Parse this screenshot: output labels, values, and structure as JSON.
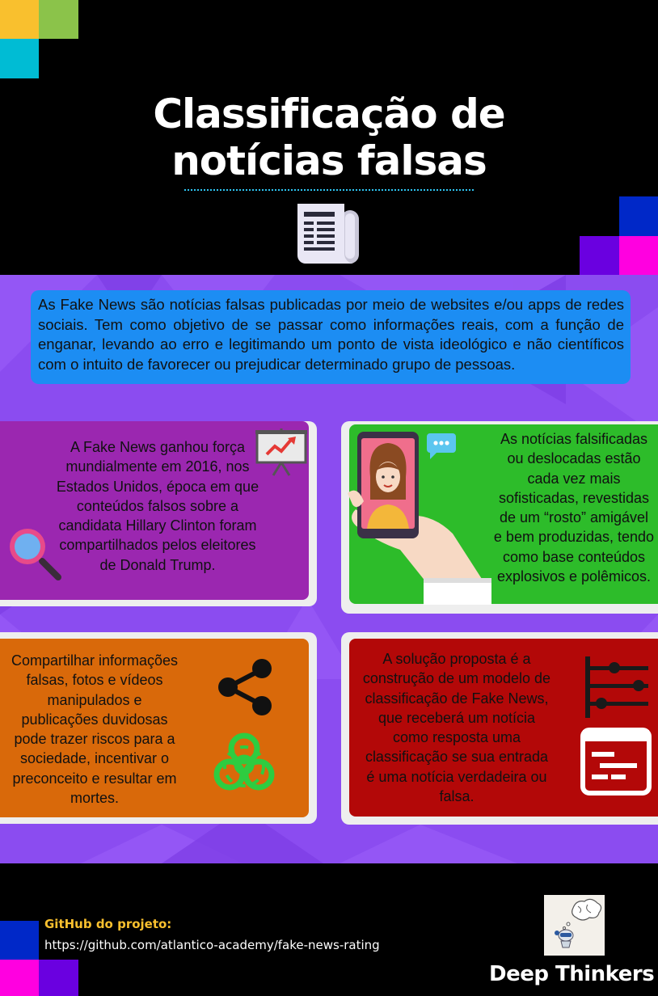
{
  "header": {
    "title_line1": "Classificação de",
    "title_line2": "notícias falsas"
  },
  "intro": {
    "text": "As Fake News são notícias falsas publicadas por meio de websites e/ou apps de redes sociais. Tem como objetivo de se passar como informações reais, com a função de enganar, levando ao erro e legitimando um ponto de vista ideológico e não científicos com o intuito de favorecer ou prejudicar determinado grupo de pessoas."
  },
  "cards": {
    "history": {
      "lines": [
        "A Fake News ganhou força",
        "mundialmente em 2016, nos",
        "Estados Unidos, época em que",
        "conteúdos falsos sobre a",
        "candidata Hillary Clinton foram",
        "compartilhados pelos eleitores",
        "de Donald Trump."
      ],
      "color": "#9b27b0"
    },
    "sophistication": {
      "lines": [
        "As notícias falsificadas",
        "ou deslocadas estão",
        "cada vez mais",
        "sofisticadas, revestidas",
        "de um “rosto” amigável",
        "e bem produzidas, tendo",
        "como base conteúdos",
        "explosivos e polêmicos."
      ],
      "color": "#2dbc2a"
    },
    "risks": {
      "lines": [
        "Compartilhar informações",
        "falsas, fotos e vídeos",
        "manipulados e",
        "publicações duvidosas",
        "pode trazer riscos para a",
        "sociedade, incentivar o",
        "preconceito e resultar em",
        "mortes."
      ],
      "color": "#d9690a"
    },
    "solution": {
      "lines": [
        "A solução proposta é a",
        "construção de um modelo de",
        "classificação de Fake News,",
        "que receberá um notícia",
        "como resposta uma",
        "classificação se sua entrada",
        "é uma notícia verdadeira ou",
        "falsa."
      ],
      "color": "#b30808"
    }
  },
  "footer": {
    "github_label": "GitHub do projeto:",
    "github_url": "https://github.com/atlantico-academy/fake-news-rating",
    "team_name": "Deep Thinkers"
  },
  "colors": {
    "background": "#000000",
    "purple_section": "#8b4cf0",
    "intro_box": "#1c8df3",
    "accent_yellow": "#f9c02e",
    "accent_green": "#8bc34a",
    "accent_cyan": "#00bcd4",
    "accent_blue": "#0028c8",
    "accent_violet": "#6a00e0",
    "accent_magenta": "#ff00e0"
  },
  "icons": [
    "newspaper-icon",
    "presentation-chart-icon",
    "magnifier-icon",
    "smartphone-user-icon",
    "chat-bubble-icon",
    "share-icon",
    "biohazard-icon",
    "slider-icon",
    "dashboard-icon",
    "robot-logo-icon"
  ]
}
